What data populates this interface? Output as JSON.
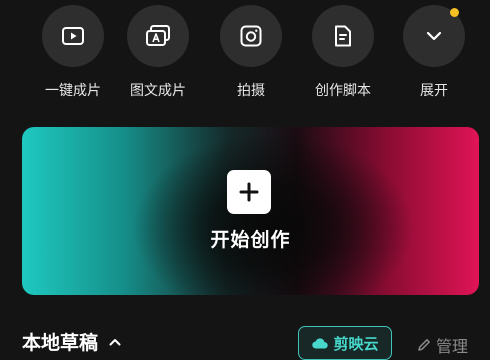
{
  "quick_tools": [
    {
      "label": "一键成片",
      "icon": "play-video-icon"
    },
    {
      "label": "图文成片",
      "icon": "text-to-video-icon"
    },
    {
      "label": "拍摄",
      "icon": "camera-icon"
    },
    {
      "label": "创作脚本",
      "icon": "script-document-icon"
    },
    {
      "label": "展开",
      "icon": "chevron-down-icon"
    }
  ],
  "expand_notification": true,
  "create": {
    "label": "开始创作",
    "icon": "plus-icon"
  },
  "drafts": {
    "title": "本地草稿",
    "collapse_icon": "chevron-up-icon",
    "cloud_button": "剪映云",
    "manage_button": "管理"
  },
  "colors": {
    "background": "#141414",
    "tool_circle": "#2e2e2e",
    "accent_teal": "#47d7cb",
    "gradient_left": "#1ec9c0",
    "gradient_right": "#e01456",
    "notification_dot": "#f5c125"
  }
}
